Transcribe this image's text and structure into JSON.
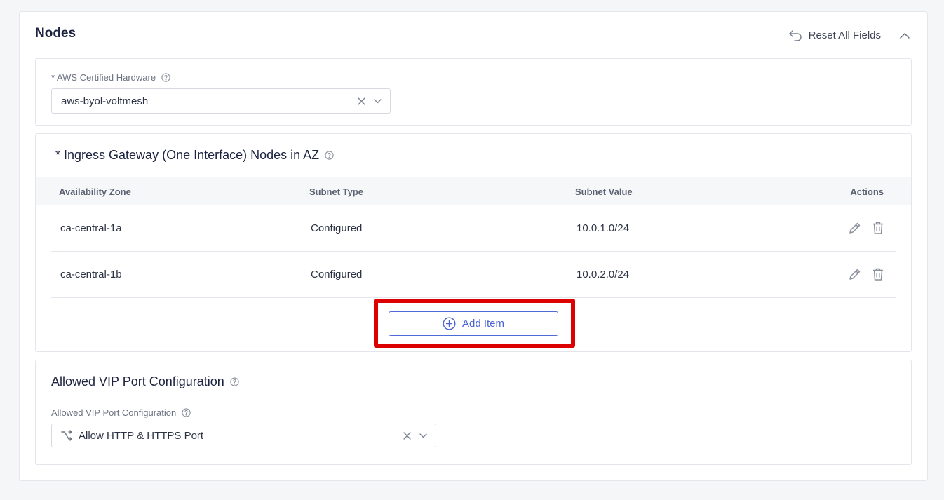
{
  "panel": {
    "title": "Nodes",
    "reset_label": "Reset All Fields"
  },
  "hardware": {
    "label": "* AWS Certified Hardware",
    "value": "aws-byol-voltmesh"
  },
  "ingress": {
    "title": "* Ingress Gateway (One Interface) Nodes in AZ",
    "columns": [
      "Availability Zone",
      "Subnet Type",
      "Subnet Value",
      "Actions"
    ],
    "rows": [
      {
        "zone": "ca-central-1a",
        "subnet_type": "Configured",
        "subnet_value": "10.0.1.0/24"
      },
      {
        "zone": "ca-central-1b",
        "subnet_type": "Configured",
        "subnet_value": "10.0.2.0/24"
      }
    ],
    "add_label": "Add Item"
  },
  "vip": {
    "title": "Allowed VIP Port Configuration",
    "label": "Allowed VIP Port Configuration",
    "value": "Allow HTTP & HTTPS Port"
  },
  "colors": {
    "accent": "#4a64d6",
    "highlight": "#dd0000",
    "title": "#1c2340"
  }
}
